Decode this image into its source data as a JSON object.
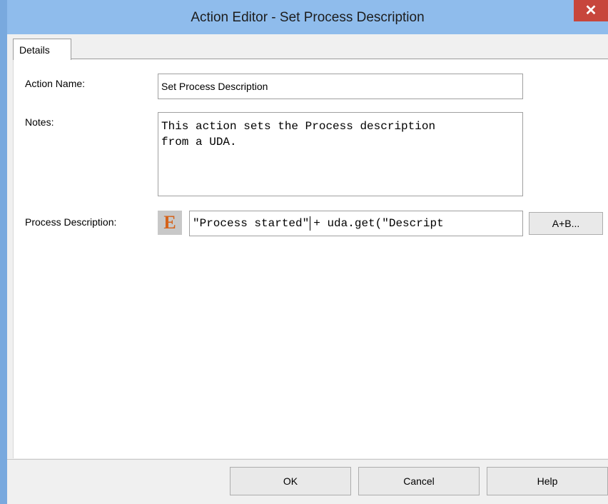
{
  "window": {
    "title": "Action Editor - Set Process Description",
    "close_glyph": "✕"
  },
  "tabs": [
    {
      "label": "Details"
    }
  ],
  "form": {
    "action_name_label": "Action Name:",
    "action_name_value": "Set Process Description",
    "notes_label": "Notes:",
    "notes_line1": "This action sets the Process description",
    "notes_line2": "from a UDA.",
    "process_description_label": "Process Description:",
    "expression_icon_letter": "E",
    "expression_before_caret": "\"Process started\"",
    "expression_after_caret": "+ uda.get(\"Descript",
    "expression_builder_label": "A+B..."
  },
  "footer": {
    "ok_label": "OK",
    "cancel_label": "Cancel",
    "help_label": "Help"
  },
  "colors": {
    "titlebar": "#8fbcec",
    "close_button": "#c7463c",
    "expression_icon": "#d4621a"
  }
}
